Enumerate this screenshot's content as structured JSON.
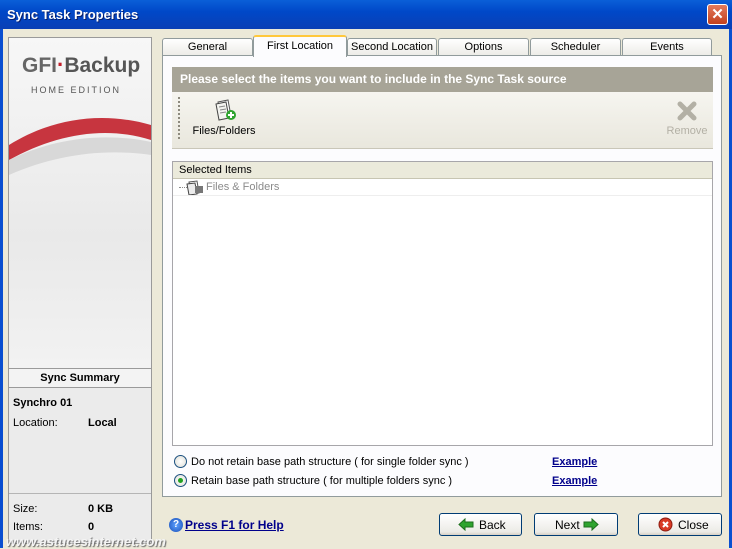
{
  "window": {
    "title": "Sync Task Properties",
    "close_glyph": "✕"
  },
  "sidebar": {
    "logo_brand": "GFI",
    "logo_product": "Backup",
    "logo_edition": "HOME EDITION",
    "summary_header": "Sync Summary",
    "task_name": "Synchro 01",
    "location_label": "Location:",
    "location_value": "Local",
    "size_label": "Size:",
    "size_value": "0 KB",
    "items_label": "Items:",
    "items_value": "0"
  },
  "tabs": [
    {
      "label": "General"
    },
    {
      "label": "First Location"
    },
    {
      "label": "Second Location"
    },
    {
      "label": "Options"
    },
    {
      "label": "Scheduler"
    },
    {
      "label": "Events"
    }
  ],
  "active_tab": "First Location",
  "instruction": "Please select the items you want to include in the Sync Task source",
  "toolbar": {
    "files_label": "Files/Folders",
    "files_icon": "add-files-icon",
    "remove_label": "Remove",
    "remove_icon": "remove-x-icon"
  },
  "list": {
    "header": "Selected Items",
    "items": [
      {
        "label": "Files & Folders",
        "icon": "files-folders-icon"
      }
    ]
  },
  "options": {
    "no_retain_label": "Do not retain base path structure ( for single folder sync )",
    "retain_label": "Retain base path structure ( for multiple folders sync )",
    "selected": "retain",
    "example_label": "Example"
  },
  "footer": {
    "help_label": "Press F1 for Help",
    "back_label": "Back",
    "next_label": "Next",
    "close_label": "Close"
  },
  "watermark": "www.astucesinternet.com",
  "colors": {
    "title_bar": "#0048c8",
    "dialog_bg": "#ece9d8",
    "instruction_bar": "#a7a497",
    "link": "#00008b",
    "brand_red": "#c2202b"
  }
}
